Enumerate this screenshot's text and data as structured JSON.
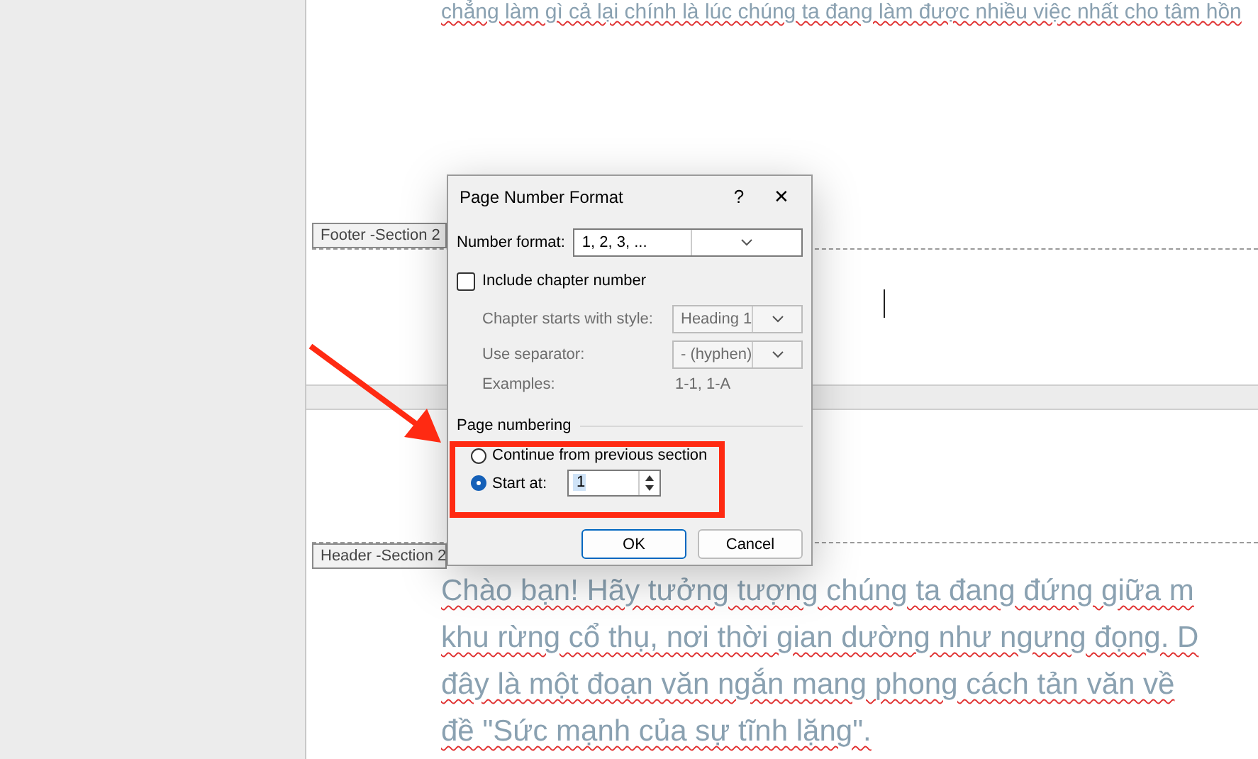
{
  "document": {
    "page_1": {
      "text_lines": [
        "chẳng làm gì cả lại chính là lúc chúng ta đang làm được nhiều việc nhất cho tâm hồn"
      ],
      "footer_tag": "Footer -Section 2"
    },
    "page_2": {
      "header_tag": "Header -Section 2",
      "text_lines": [
        "Chào bạn! Hãy tưởng tượng chúng ta đang đứng giữa m",
        "khu rừng cổ thụ, nơi thời gian dường như ngưng đọng. D",
        "đây là một đoạn văn ngắn mang phong cách tản văn về",
        "đề \"Sức mạnh của sự tĩnh lặng\"."
      ]
    }
  },
  "dialog": {
    "title": "Page Number Format",
    "help": "?",
    "close": "✕",
    "number_format": {
      "label": "Number format:",
      "value": "1, 2, 3, ..."
    },
    "include_chapter": {
      "label": "Include chapter number",
      "checked": false
    },
    "chapter_fields": [
      {
        "kind": "select",
        "label": "Chapter starts with style:",
        "value": "Heading 1",
        "disabled": true
      },
      {
        "kind": "select",
        "label": "Use separator:",
        "value": "-   (hyphen)",
        "disabled": true
      },
      {
        "kind": "text",
        "label": "Examples:",
        "value": "1-1, 1-A",
        "disabled": true
      }
    ],
    "page_numbering": {
      "label": "Page numbering",
      "options": [
        {
          "label": "Continue from previous section",
          "selected": false
        },
        {
          "label": "Start at:",
          "selected": true
        }
      ],
      "start_at": "1"
    },
    "buttons": [
      {
        "label": "OK",
        "default": true
      },
      {
        "label": "Cancel",
        "default": false
      }
    ]
  }
}
